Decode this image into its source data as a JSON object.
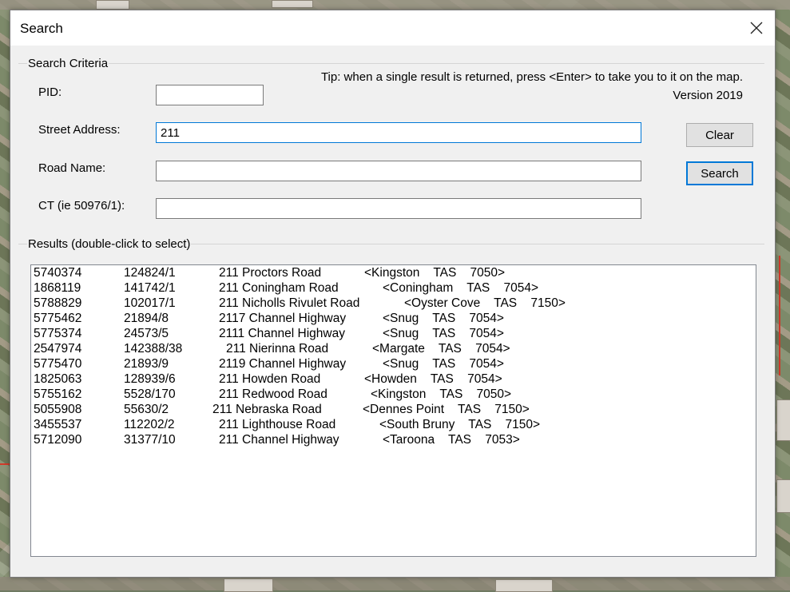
{
  "window": {
    "title": "Search"
  },
  "criteria": {
    "group_label": "Search Criteria",
    "tip": "Tip: when a single result is returned, press <Enter> to take you to it on the map.",
    "version": "Version 2019",
    "pid_label": "PID:",
    "pid_value": "",
    "street_label": "Street Address:",
    "street_value": "211",
    "road_label": "Road Name:",
    "road_value": "",
    "ct_label": "CT (ie 50976/1):",
    "ct_value": "",
    "clear_label": "Clear",
    "search_label": "Search"
  },
  "results": {
    "label": "Results (double-click to select)",
    "rows": [
      {
        "pid": "5740374",
        "ct": "124824/1",
        "address": "211 Proctors Road",
        "locality": "<Kingston    TAS    7050>"
      },
      {
        "pid": "1868119",
        "ct": "141742/1",
        "address": "211 Coningham Road",
        "locality": "<Coningham    TAS    7054>"
      },
      {
        "pid": "5788829",
        "ct": "102017/1",
        "address": "211 Nicholls Rivulet Road",
        "locality": "<Oyster Cove    TAS    7150>"
      },
      {
        "pid": "5775462",
        "ct": "21894/8",
        "address": "2117 Channel Highway",
        "locality": "<Snug    TAS    7054>"
      },
      {
        "pid": "5775374",
        "ct": "24573/5",
        "address": "2111 Channel Highway",
        "locality": "<Snug    TAS    7054>"
      },
      {
        "pid": "2547974",
        "ct": "142388/38",
        "address": "211 Nierinna Road",
        "locality": "<Margate    TAS    7054>"
      },
      {
        "pid": "5775470",
        "ct": "21893/9",
        "address": "2119 Channel Highway",
        "locality": "<Snug    TAS    7054>"
      },
      {
        "pid": "1825063",
        "ct": "128939/6",
        "address": "211 Howden Road",
        "locality": "<Howden    TAS    7054>"
      },
      {
        "pid": "5755162",
        "ct": "5528/170",
        "address": "211 Redwood Road",
        "locality": "<Kingston    TAS    7050>"
      },
      {
        "pid": "5055908",
        "ct": "55630/2",
        "address": "211 Nebraska Road",
        "locality": "<Dennes Point    TAS    7150>"
      },
      {
        "pid": "3455537",
        "ct": "112202/2",
        "address": "211 Lighthouse Road",
        "locality": "<South Bruny    TAS    7150>"
      },
      {
        "pid": "5712090",
        "ct": "31377/10",
        "address": "211 Channel Highway",
        "locality": "<Taroona    TAS    7053>"
      }
    ]
  }
}
